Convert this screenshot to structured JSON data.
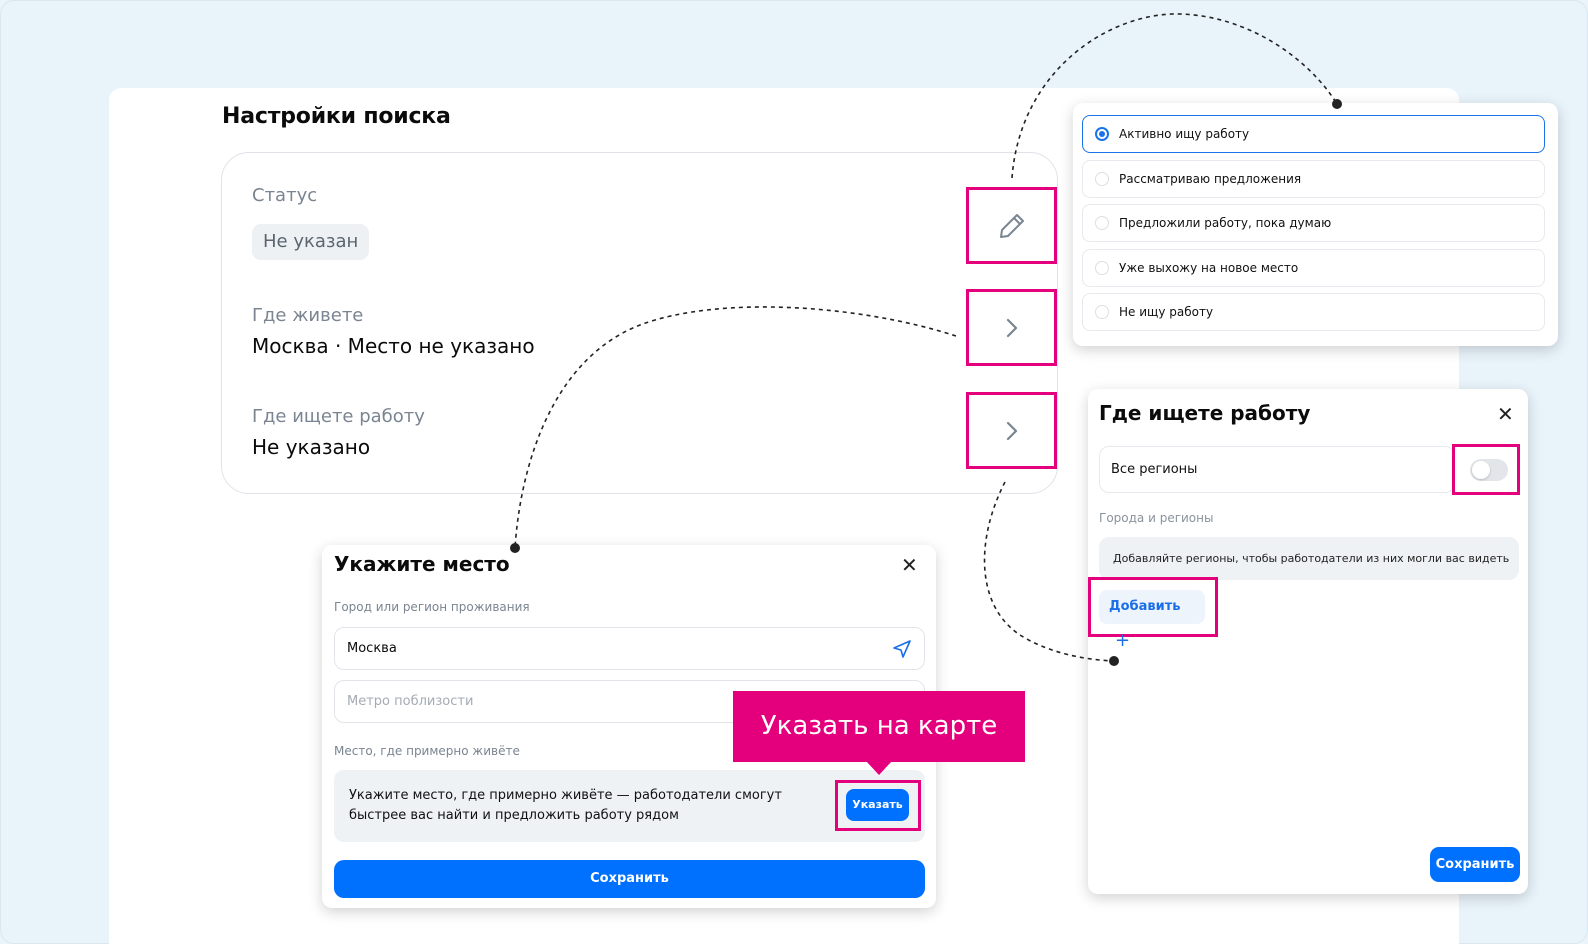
{
  "settings": {
    "title": "Настройки поиска",
    "status_label": "Статус",
    "status_value": "Не указан",
    "residence_label": "Где живете",
    "residence_value": "Москва · Место не указано",
    "work_label": "Где ищете работу",
    "work_value": "Не указано"
  },
  "status_options": [
    {
      "label": "Активно ищу работу",
      "selected": true
    },
    {
      "label": "Рассматриваю предложения",
      "selected": false
    },
    {
      "label": "Предложили работу, пока думаю",
      "selected": false
    },
    {
      "label": "Уже выхожу на новое место",
      "selected": false
    },
    {
      "label": "Не ищу работу",
      "selected": false
    }
  ],
  "work_region_panel": {
    "title": "Где ищете работу",
    "close_icon": "close-icon",
    "all_regions_label": "Все регионы",
    "all_regions_enabled": false,
    "cities_label": "Города и регионы",
    "hint": "Добавляйте регионы, чтобы работодатели из них могли вас видеть",
    "add_label": "Добавить",
    "save_label": "Сохранить"
  },
  "place_panel": {
    "title": "Укажите место",
    "close_icon": "close-icon",
    "city_label": "Город или регион проживания",
    "city_value": "Москва",
    "metro_placeholder": "Метро поблизости",
    "approx_label": "Место, где примерно живёте",
    "approx_hint": "Укажите место, где примерно живёте — работодатели смогут быстрее вас найти и предложить работу рядом",
    "point_label": "Указать",
    "save_label": "Сохранить"
  },
  "annotation": {
    "tooltip": "Указать на карте",
    "highlight_color": "#e4007c"
  },
  "colors": {
    "accent": "#0070ff",
    "background": "#eaf4fa"
  }
}
